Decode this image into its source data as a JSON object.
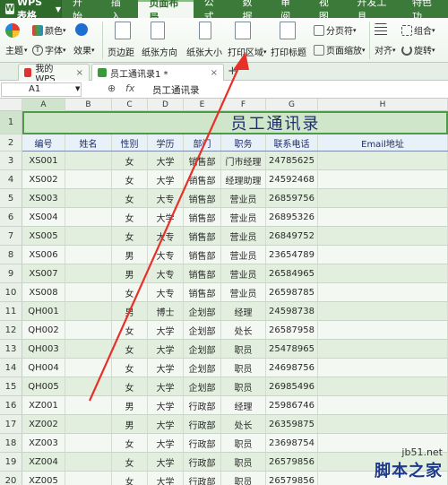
{
  "menubar": {
    "app_name": "WPS 表格",
    "tabs": [
      "开始",
      "插入",
      "页面布局",
      "公式",
      "数据",
      "审阅",
      "视图",
      "开发工具",
      "特色功"
    ],
    "active_tab": "页面布局"
  },
  "ribbon": {
    "theme": "主题",
    "color": "颜色",
    "font": "字体",
    "effect": "效果",
    "margin": "页边距",
    "orientation": "纸张方向",
    "size": "纸张大小",
    "print_area": "打印区域",
    "print_titles": "打印标题",
    "page_break": "分页符",
    "page_zoom": "页面缩放",
    "align": "对齐",
    "group": "组合",
    "rotate": "旋转"
  },
  "doc_tabs": {
    "tab1": "我的WPS",
    "tab2": "员工通讯录1 *",
    "add": "+"
  },
  "formula_bar": {
    "cell_ref": "A1",
    "fx": "fx",
    "content": "员工通讯录"
  },
  "columns": [
    "A",
    "B",
    "C",
    "D",
    "E",
    "F",
    "G",
    "H"
  ],
  "row_numbers": [
    "1",
    "2",
    "3",
    "4",
    "5",
    "6",
    "7",
    "8",
    "9",
    "10",
    "11",
    "12",
    "13",
    "14",
    "15",
    "16",
    "17",
    "18",
    "19",
    "20"
  ],
  "sheet": {
    "title": "员工通讯录",
    "headers": [
      "编号",
      "姓名",
      "性别",
      "学历",
      "部门",
      "职务",
      "联系电话",
      "Email地址"
    ],
    "rows": [
      [
        "XS001",
        "",
        "女",
        "大学",
        "销售部",
        "门市经理",
        "24785625",
        ""
      ],
      [
        "XS002",
        "",
        "女",
        "大学",
        "销售部",
        "经理助理",
        "24592468",
        ""
      ],
      [
        "XS003",
        "",
        "女",
        "大专",
        "销售部",
        "营业员",
        "26859756",
        ""
      ],
      [
        "XS004",
        "",
        "女",
        "大学",
        "销售部",
        "营业员",
        "26895326",
        ""
      ],
      [
        "XS005",
        "",
        "女",
        "大专",
        "销售部",
        "营业员",
        "26849752",
        ""
      ],
      [
        "XS006",
        "",
        "男",
        "大专",
        "销售部",
        "营业员",
        "23654789",
        ""
      ],
      [
        "XS007",
        "",
        "男",
        "大专",
        "销售部",
        "营业员",
        "26584965",
        ""
      ],
      [
        "XS008",
        "",
        "女",
        "大专",
        "销售部",
        "营业员",
        "26598785",
        ""
      ],
      [
        "QH001",
        "",
        "男",
        "博士",
        "企划部",
        "经理",
        "24598738",
        ""
      ],
      [
        "QH002",
        "",
        "女",
        "大学",
        "企划部",
        "处长",
        "26587958",
        ""
      ],
      [
        "QH003",
        "",
        "女",
        "大学",
        "企划部",
        "职员",
        "25478965",
        ""
      ],
      [
        "QH004",
        "",
        "女",
        "大学",
        "企划部",
        "职员",
        "24698756",
        ""
      ],
      [
        "QH005",
        "",
        "女",
        "大学",
        "企划部",
        "职员",
        "26985496",
        ""
      ],
      [
        "XZ001",
        "",
        "男",
        "大学",
        "行政部",
        "经理",
        "25986746",
        ""
      ],
      [
        "XZ002",
        "",
        "男",
        "大学",
        "行政部",
        "处长",
        "26359875",
        ""
      ],
      [
        "XZ003",
        "",
        "女",
        "大学",
        "行政部",
        "职员",
        "23698754",
        ""
      ],
      [
        "XZ004",
        "",
        "女",
        "大学",
        "行政部",
        "职员",
        "26579856",
        ""
      ],
      [
        "XZ005",
        "",
        "女",
        "大学",
        "行政部",
        "职员",
        "26579856",
        ""
      ]
    ]
  },
  "watermark": {
    "url": "jb51.net",
    "name": "脚本之家"
  },
  "colors": {
    "menubar": "#3c7a3a",
    "title_fill": "#cfe6ca",
    "arrow": "#e8302a"
  }
}
